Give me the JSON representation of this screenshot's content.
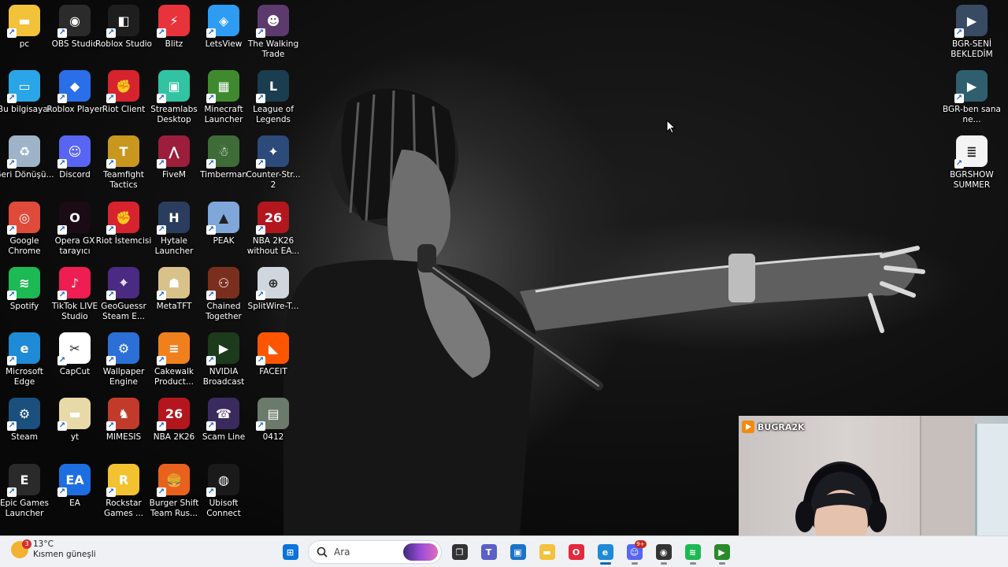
{
  "desktop": {
    "icons": [
      {
        "label": "pc",
        "icon": "folder-icon",
        "color": "#f2c23b"
      },
      {
        "label": "OBS Studio",
        "icon": "obs-icon",
        "color": "#2b2b2b"
      },
      {
        "label": "Roblox Studio",
        "icon": "roblox-studio-icon",
        "color": "#1e1e1e"
      },
      {
        "label": "Blitz",
        "icon": "blitz-icon",
        "color": "#e8323c"
      },
      {
        "label": "LetsView",
        "icon": "letsview-icon",
        "color": "#2d9cf2"
      },
      {
        "label": "The Walking Trade",
        "icon": "walking-trade-icon",
        "color": "#5c3a6e"
      },
      {
        "label": "Bu bilgisayar",
        "icon": "monitor-icon",
        "color": "#2aa6e8"
      },
      {
        "label": "Roblox Player",
        "icon": "roblox-player-icon",
        "color": "#2a6ee8"
      },
      {
        "label": "Riot Client",
        "icon": "riot-client-icon",
        "color": "#d6232e"
      },
      {
        "label": "Streamlabs Desktop",
        "icon": "streamlabs-icon",
        "color": "#31c3a2"
      },
      {
        "label": "Minecraft Launcher",
        "icon": "minecraft-icon",
        "color": "#3f8a2f"
      },
      {
        "label": "League of Legends",
        "icon": "league-icon",
        "color": "#1a3d4f"
      },
      {
        "label": "Geri Dönüşü...",
        "icon": "recycle-bin-icon",
        "color": "#9fb3c8"
      },
      {
        "label": "Discord",
        "icon": "discord-icon",
        "color": "#5865f2"
      },
      {
        "label": "Teamfight Tactics",
        "icon": "tft-icon",
        "color": "#c9961e"
      },
      {
        "label": "FiveM",
        "icon": "fivem-icon",
        "color": "#9c1d3c"
      },
      {
        "label": "Timberman",
        "icon": "timberman-icon",
        "color": "#3e6b37"
      },
      {
        "label": "Counter-Str... 2",
        "icon": "counter-strike-icon",
        "color": "#2c4a7a"
      },
      {
        "label": "Google Chrome",
        "icon": "chrome-icon",
        "color": "#e04a3a"
      },
      {
        "label": "Opera GX tarayıcı",
        "icon": "opera-gx-icon",
        "color": "#1a0b14"
      },
      {
        "label": "Riot İstemcisi",
        "icon": "riot-client-icon",
        "color": "#d6232e"
      },
      {
        "label": "Hytale Launcher",
        "icon": "hytale-icon",
        "color": "#2a3d5e"
      },
      {
        "label": "PEAK",
        "icon": "peak-icon",
        "color": "#7fa7d9"
      },
      {
        "label": "NBA 2K26 without EA...",
        "icon": "nba2k26-icon",
        "color": "#b4161e"
      },
      {
        "label": "Spotify",
        "icon": "spotify-icon",
        "color": "#1db954"
      },
      {
        "label": "TikTok LIVE Studio",
        "icon": "tiktok-icon",
        "color": "#ee1d52"
      },
      {
        "label": "GeoGuessr Steam E...",
        "icon": "geoguessr-icon",
        "color": "#4a2a82"
      },
      {
        "label": "MetaTFT",
        "icon": "metatft-icon",
        "color": "#d9c18a"
      },
      {
        "label": "Chained Together",
        "icon": "chained-together-icon",
        "color": "#7a2f1e"
      },
      {
        "label": "SplitWire-T...",
        "icon": "splitwire-icon",
        "color": "#cfd6dd"
      },
      {
        "label": "Microsoft Edge",
        "icon": "edge-icon",
        "color": "#1f8ad6"
      },
      {
        "label": "CapCut",
        "icon": "capcut-icon",
        "color": "#ffffff"
      },
      {
        "label": "Wallpaper Engine",
        "icon": "wallpaper-engine-icon",
        "color": "#2c6fd6"
      },
      {
        "label": "Cakewalk Product...",
        "icon": "cakewalk-icon",
        "color": "#f0801e"
      },
      {
        "label": "NVIDIA Broadcast",
        "icon": "nvidia-broadcast-icon",
        "color": "#1c3a1c"
      },
      {
        "label": "FACEIT",
        "icon": "faceit-icon",
        "color": "#ff5500"
      },
      {
        "label": "Steam",
        "icon": "steam-icon",
        "color": "#1b4f7e"
      },
      {
        "label": "yt",
        "icon": "folder-icon",
        "color": "#e8d9a8"
      },
      {
        "label": "MIMESIS",
        "icon": "mimesis-icon",
        "color": "#c23a2a"
      },
      {
        "label": "NBA 2K26",
        "icon": "nba2k26-icon",
        "color": "#b4161e"
      },
      {
        "label": "Scam Line",
        "icon": "scam-line-icon",
        "color": "#3a2b5e"
      },
      {
        "label": "0412",
        "icon": "image-file-icon",
        "color": "#6b7a6b"
      },
      {
        "label": "Epic Games Launcher",
        "icon": "epic-games-icon",
        "color": "#2a2a2a"
      },
      {
        "label": "EA",
        "icon": "ea-icon",
        "color": "#1d6ee0"
      },
      {
        "label": "Rockstar Games ...",
        "icon": "rockstar-icon",
        "color": "#f2c230"
      },
      {
        "label": "Burger Shift Team Rus...",
        "icon": "burger-shift-icon",
        "color": "#e8621e"
      },
      {
        "label": "Ubisoft Connect",
        "icon": "ubisoft-icon",
        "color": "#1a1a1a"
      }
    ],
    "right_icons": [
      {
        "label": "BGR-SENİ BEKLEDİM",
        "icon": "video-thumbnail-icon",
        "color": "#394a63"
      },
      {
        "label": "BGR-ben sana ne...",
        "icon": "video-thumbnail-icon",
        "color": "#2f5f6e"
      },
      {
        "label": "BGRSHOW SUMMER",
        "icon": "text-file-icon",
        "color": "#f4f4f4"
      }
    ]
  },
  "taskbar": {
    "weather": {
      "temp": "13°C",
      "desc": "Kısmen güneşli",
      "badge": "3"
    },
    "search_placeholder": "Ara",
    "apps": [
      {
        "name": "start-button",
        "icon": "windows-icon",
        "color": "#0a74da",
        "running": false
      },
      {
        "name": "search",
        "icon": "search-icon"
      },
      {
        "name": "task-view-button",
        "icon": "task-view-icon",
        "color": "#333333",
        "running": false
      },
      {
        "name": "teams-button",
        "icon": "teams-icon",
        "color": "#5b5fc7",
        "running": false
      },
      {
        "name": "store-button",
        "icon": "store-icon",
        "color": "#1a73c8",
        "running": false
      },
      {
        "name": "file-explorer-button",
        "icon": "folder-icon",
        "color": "#f2c23b",
        "running": false
      },
      {
        "name": "opera-button",
        "icon": "opera-gx-icon",
        "color": "#e5283c",
        "running": false
      },
      {
        "name": "edge-button",
        "icon": "edge-icon",
        "color": "#1f8ad6",
        "running": true,
        "active": true
      },
      {
        "name": "discord-button",
        "icon": "discord-icon",
        "color": "#5865f2",
        "running": true,
        "badge": "9+"
      },
      {
        "name": "obs-button",
        "icon": "obs-icon",
        "color": "#333333",
        "running": true
      },
      {
        "name": "spotify-button",
        "icon": "spotify-icon",
        "color": "#1db954",
        "running": true
      },
      {
        "name": "nvidia-broadcast-button",
        "icon": "nvidia-broadcast-icon",
        "color": "#2a8a2a",
        "running": true
      }
    ]
  },
  "webcam": {
    "channel": "BUGRA2K"
  }
}
